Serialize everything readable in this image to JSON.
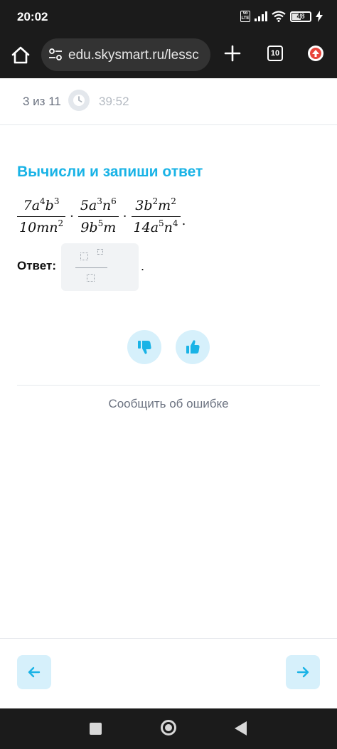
{
  "status_bar": {
    "time": "20:02",
    "network": "Vo LTE",
    "battery": "48"
  },
  "browser": {
    "url": "edu.skysmart.ru/lessc",
    "tabs_count": "10",
    "icons": [
      "home-icon",
      "site-settings-icon",
      "new-tab-icon",
      "tabs-icon",
      "update-icon"
    ]
  },
  "progress": {
    "position": "3 из 11",
    "timer": "39:52"
  },
  "task": {
    "title": "Вычисли и запиши ответ",
    "fractions": [
      {
        "num_parts": [
          "7",
          "a",
          "4",
          "b",
          "3"
        ],
        "den_parts": [
          "10",
          "mn",
          "2"
        ]
      },
      {
        "num_parts": [
          "5",
          "a",
          "3",
          "n",
          "6"
        ],
        "den_parts": [
          "9",
          "b",
          "5",
          "m"
        ]
      },
      {
        "num_parts": [
          "3",
          "b",
          "2",
          "m",
          "2"
        ],
        "den_parts": [
          "14",
          "a",
          "5",
          "n",
          "4"
        ]
      }
    ],
    "operator": "·",
    "end": "."
  },
  "answer": {
    "label": "Ответ:",
    "end": "."
  },
  "feedback": {
    "report_label": "Сообщить об ошибке"
  },
  "colors": {
    "accent": "#19b3e6",
    "accent_bg": "#d6f0fb",
    "muted_text": "#6b7280"
  }
}
